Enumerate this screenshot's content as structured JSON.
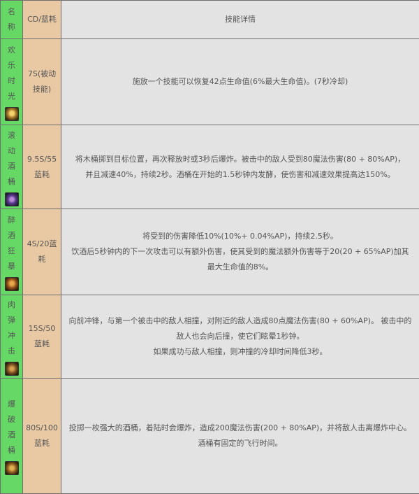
{
  "header": {
    "name": "名称",
    "cd": "CD/蓝耗",
    "detail": "技能详情"
  },
  "skills": [
    {
      "name": "欢乐时光",
      "icon": "barrel-cheer-icon",
      "cd": "7S(被动技能)",
      "lines": [
        "施放一个技能可以恢复42点生命值(6%最大生命值)。(7秒冷却)"
      ]
    },
    {
      "name": "滚动酒桶",
      "icon": "rolling-barrel-icon",
      "cd": "9.5S/55蓝耗",
      "lines": [
        "将木桶掷到目标位置，再次释放时或3秒后爆炸。被击中的敌人受到80魔法伤害(80 + 80%AP)，并且减速40%，持续2秒。酒桶在开始的1.5秒钟内发酵，使伤害和减速效果提高达150%。"
      ]
    },
    {
      "name": "醉酒狂暴",
      "icon": "drunken-rage-icon",
      "cd": "4S/20蓝耗",
      "lines": [
        "将受到的伤害降低10%(10%+ 0.04%AP)，持续2.5秒。",
        "饮酒后5秒钟内的下一次攻击可以有额外伤害，使其受到的魔法额外伤害等于20(20 + 65%AP)加其最大生命值的8%。"
      ]
    },
    {
      "name": "肉弹冲击",
      "icon": "body-slam-icon",
      "cd": "15S/50蓝耗",
      "lines": [
        "向前冲锋，与第一个被击中的敌人相撞，对附近的敌人造成80点魔法伤害(80 + 60%AP)。 被击中的敌人也会向后撞，使它们眩晕1秒钟。",
        "如果成功与敌人相撞，则冲撞的冷却时间降低3秒。"
      ]
    },
    {
      "name": "爆破酒桶",
      "icon": "explosive-cask-icon",
      "cd": "80S/100蓝耗",
      "lines": [
        "投掷一枚强大的酒桶，着陆时会爆炸，造成200魔法伤害(200 + 80%AP)，并将敌人击离爆炸中心。",
        "酒桶有固定的飞行时间。"
      ]
    }
  ]
}
